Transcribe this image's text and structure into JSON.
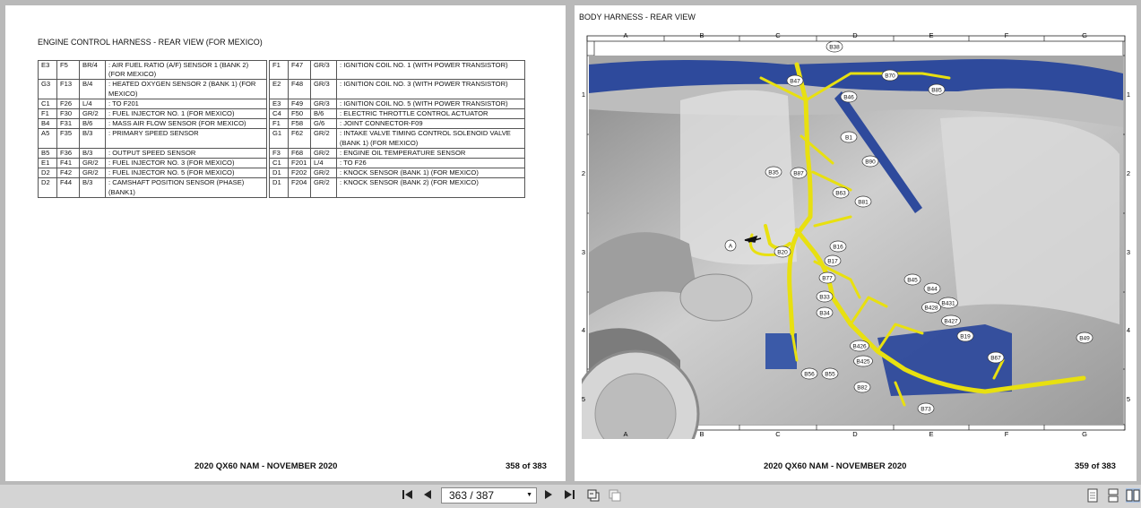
{
  "left_page": {
    "title": "ENGINE CONTROL HARNESS - REAR VIEW (FOR MEXICO)",
    "rows": [
      {
        "a": {
          "coord": "E3",
          "conn": "F5",
          "wire": "BR/4",
          "desc": ": AIR FUEL RATIO (A/F) SENSOR 1 (BANK 2) (FOR MEXICO)"
        },
        "b": {
          "coord": "F1",
          "conn": "F47",
          "wire": "GR/3",
          "desc": ": IGNITION COIL NO. 1 (WITH POWER TRANSISTOR)"
        }
      },
      {
        "a": {
          "coord": "G3",
          "conn": "F13",
          "wire": "B/4",
          "desc": ": HEATED OXYGEN SENSOR 2 (BANK 1) (FOR MEXICO)"
        },
        "b": {
          "coord": "E2",
          "conn": "F48",
          "wire": "GR/3",
          "desc": ": IGNITION COIL NO. 3 (WITH POWER TRANSISTOR)"
        }
      },
      {
        "a": {
          "coord": "C1",
          "conn": "F26",
          "wire": "L/4",
          "desc": ": TO F201"
        },
        "b": {
          "coord": "E3",
          "conn": "F49",
          "wire": "GR/3",
          "desc": ": IGNITION COIL NO. 5 (WITH POWER TRANSISTOR)"
        }
      },
      {
        "a": {
          "coord": "F1",
          "conn": "F30",
          "wire": "GR/2",
          "desc": ": FUEL INJECTOR NO. 1 (FOR MEXICO)"
        },
        "b": {
          "coord": "C4",
          "conn": "F50",
          "wire": "B/6",
          "desc": ": ELECTRIC THROTTLE CONTROL ACTUATOR"
        }
      },
      {
        "a": {
          "coord": "B4",
          "conn": "F31",
          "wire": "B/6",
          "desc": ": MASS AIR FLOW SENSOR (FOR MEXICO)"
        },
        "b": {
          "coord": "F1",
          "conn": "F58",
          "wire": "G/6",
          "desc": ": JOINT CONNECTOR-F09"
        }
      },
      {
        "a": {
          "coord": "A5",
          "conn": "F35",
          "wire": "B/3",
          "desc": ": PRIMARY SPEED SENSOR"
        },
        "b": {
          "coord": "G1",
          "conn": "F62",
          "wire": "GR/2",
          "desc": ": INTAKE VALVE TIMING CONTROL SOLENOID VALVE (BANK 1) (FOR MEXICO)"
        }
      },
      {
        "a": {
          "coord": "B5",
          "conn": "F36",
          "wire": "B/3",
          "desc": ": OUTPUT SPEED SENSOR"
        },
        "b": {
          "coord": "F3",
          "conn": "F68",
          "wire": "GR/2",
          "desc": ": ENGINE OIL TEMPERATURE SENSOR"
        }
      },
      {
        "a": {
          "coord": "E1",
          "conn": "F41",
          "wire": "GR/2",
          "desc": ": FUEL INJECTOR NO. 3 (FOR MEXICO)"
        },
        "b": {
          "coord": "C1",
          "conn": "F201",
          "wire": "L/4",
          "desc": ": TO F26"
        }
      },
      {
        "a": {
          "coord": "D2",
          "conn": "F42",
          "wire": "GR/2",
          "desc": ": FUEL INJECTOR NO. 5 (FOR MEXICO)"
        },
        "b": {
          "coord": "D1",
          "conn": "F202",
          "wire": "GR/2",
          "desc": ": KNOCK SENSOR (BANK 1) (FOR MEXICO)"
        }
      },
      {
        "a": {
          "coord": "D2",
          "conn": "F44",
          "wire": "B/3",
          "desc": ": CAMSHAFT POSITION SENSOR (PHASE) (BANK1)"
        },
        "b": {
          "coord": "D1",
          "conn": "F204",
          "wire": "GR/2",
          "desc": ": KNOCK SENSOR (BANK 2) (FOR MEXICO)"
        }
      }
    ],
    "footer_title": "2020 QX60 NAM - NOVEMBER 2020",
    "page_number": "358 of 383"
  },
  "right_page": {
    "title": "BODY HARNESS - REAR VIEW",
    "grid_columns": [
      "A",
      "B",
      "C",
      "D",
      "E",
      "F",
      "G"
    ],
    "grid_rows": [
      "1",
      "2",
      "3",
      "4",
      "5"
    ],
    "connector_labels": [
      "B38",
      "B47",
      "B70",
      "B85",
      "B46",
      "B1",
      "B90",
      "B35",
      "B87",
      "B63",
      "B81",
      "A",
      "B20",
      "B16",
      "B17",
      "B77",
      "B45",
      "B44",
      "B33",
      "B428",
      "B431",
      "B34",
      "B427",
      "B426",
      "B19",
      "B49",
      "B425",
      "B67",
      "B56",
      "B55",
      "B82",
      "B73"
    ],
    "footer_title": "2020 QX60 NAM - NOVEMBER 2020",
    "page_number": "359 of 383"
  },
  "toolbar": {
    "first_icon": "first-page-icon",
    "prev_icon": "previous-page-icon",
    "page_indicator": "363 / 387",
    "next_icon": "next-page-icon",
    "last_icon": "last-page-icon",
    "go_back_icon": "go-back-icon",
    "go_forward_icon": "go-forward-icon",
    "view_icons": [
      "single-page-view-icon",
      "continuous-view-icon",
      "two-page-view-icon"
    ]
  },
  "colors": {
    "harness": "#e8e010",
    "panel": "#2e4a9c",
    "background": "#b9b9b9"
  }
}
